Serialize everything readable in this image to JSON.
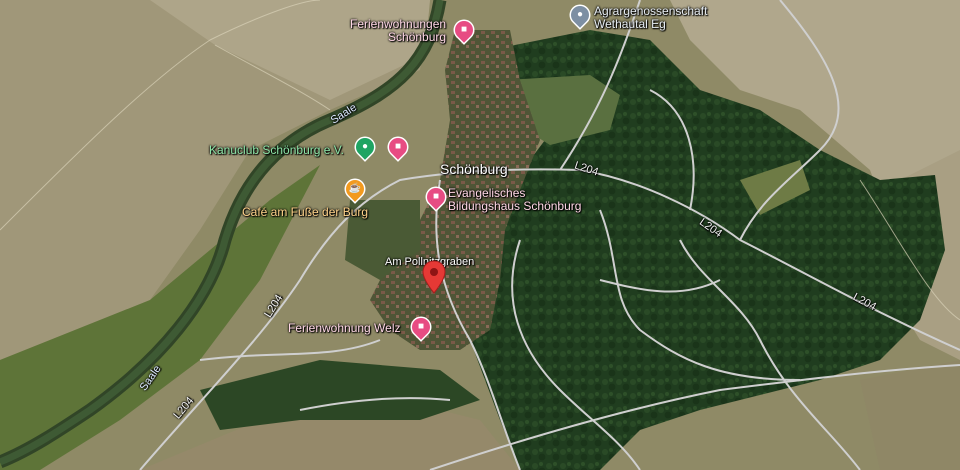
{
  "map": {
    "places": [
      {
        "id": "schonburg",
        "text": "Schönburg"
      },
      {
        "id": "am-pollnitzgraben",
        "text": "Am Pollnitzgraben"
      }
    ],
    "pois": [
      {
        "id": "ferienwohnungen",
        "lines": [
          "Ferienwohnungen",
          "Schönburg"
        ],
        "category": "lodging",
        "color": "#e74c83",
        "icon": "bed-icon"
      },
      {
        "id": "agrargenossenschaft",
        "lines": [
          "Agrargenossenschaft",
          "Wethautal Eg"
        ],
        "category": "place",
        "color": "#7d8fa3",
        "icon": "location-dot-icon"
      },
      {
        "id": "kanuclub",
        "lines": [
          "Kanuclub Schönburg e.V."
        ],
        "category": "sport",
        "color": "#1fa463",
        "icon": "location-dot-icon"
      },
      {
        "id": "hotel-unlabeled",
        "lines": [],
        "category": "lodging",
        "color": "#e74c83",
        "icon": "bed-icon"
      },
      {
        "id": "cafe",
        "lines": [
          "Café am Fuße der Burg"
        ],
        "category": "cafe",
        "color": "#f29a1f",
        "icon": "coffee-cup-icon"
      },
      {
        "id": "bildungshaus",
        "lines": [
          "Evangelisches",
          "Bildungshaus Schönburg"
        ],
        "category": "lodging",
        "color": "#e74c83",
        "icon": "bed-icon"
      },
      {
        "id": "ferienwohnung-welz",
        "lines": [
          "Ferienwohnung Welz"
        ],
        "category": "lodging",
        "color": "#e74c83",
        "icon": "bed-icon"
      }
    ],
    "selected_marker": {
      "color": "#e53935",
      "icon": "red-location-pin-icon"
    },
    "roads": [
      {
        "id": "l204-a",
        "text": "L204"
      },
      {
        "id": "l204-b",
        "text": "L204"
      },
      {
        "id": "l204-c",
        "text": "L204"
      },
      {
        "id": "l204-d",
        "text": "L204"
      },
      {
        "id": "l204-e",
        "text": "L204"
      }
    ],
    "rivers": [
      {
        "id": "saale-a",
        "text": "Saale"
      },
      {
        "id": "saale-b",
        "text": "Saale"
      }
    ]
  }
}
